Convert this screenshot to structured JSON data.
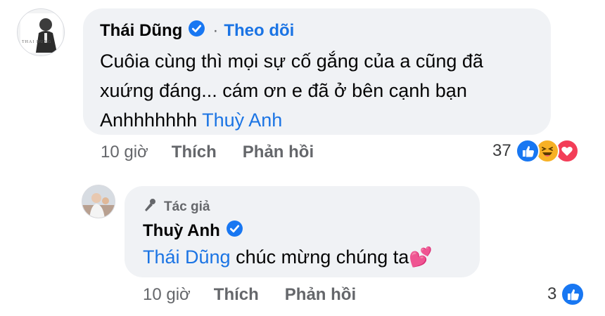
{
  "comment1": {
    "author": "Thái Dũng",
    "avatar_text": "THAI DUNG",
    "follow_label": "Theo dõi",
    "separator": "·",
    "text_line1": "Cuôia cùng thì mọi sự cố gắng của a cũng đã",
    "text_line2": "xuứng đáng... cám ơn e đã ở bên cạnh bạn",
    "text_line3_prefix": "Anhhhhhhh",
    "mention": "Thuỳ Anh",
    "time": "10 giờ",
    "like_label": "Thích",
    "reply_label": "Phản hồi",
    "reaction_count": "37",
    "reactions": [
      "like-icon",
      "haha-icon",
      "love-icon"
    ]
  },
  "comment2": {
    "badge_label": "Tác giả",
    "author": "Thuỳ Anh",
    "mention": "Thái Dũng",
    "text": "chúc mừng chúng ta",
    "emoji": "💕",
    "time": "10 giờ",
    "like_label": "Thích",
    "reply_label": "Phản hồi",
    "reaction_count": "3",
    "reactions": [
      "like-icon"
    ]
  },
  "colors": {
    "bubble": "#f0f2f5",
    "link": "#1b74e4",
    "muted": "#65676b",
    "verified": "#1877f2",
    "love": "#f33e58",
    "haha": "#f7b125"
  }
}
